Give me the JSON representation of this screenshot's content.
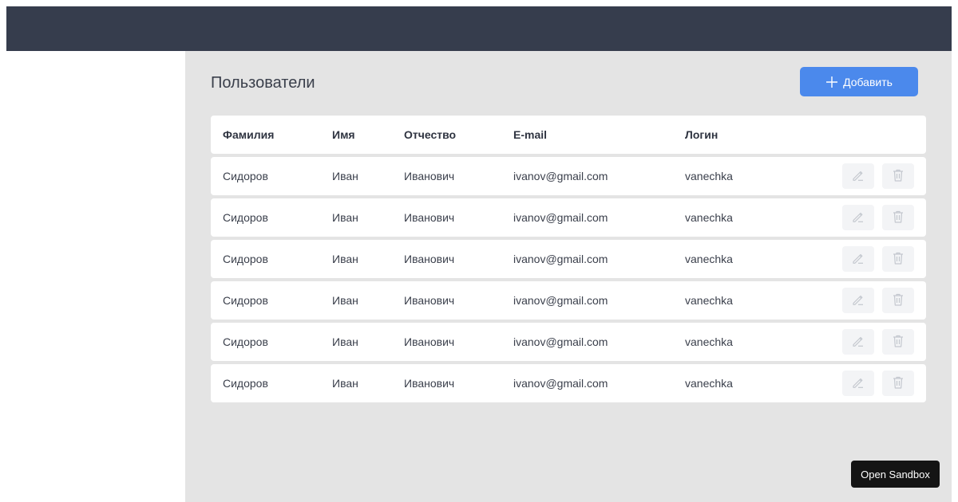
{
  "main": {
    "title": "Пользователи",
    "add_button_label": "Добавить",
    "icons": {
      "add": "plus-icon",
      "edit": "pencil-icon",
      "delete": "trash-icon"
    }
  },
  "table": {
    "headers": {
      "last_name": "Фамилия",
      "first_name": "Имя",
      "middle_name": "Отчество",
      "email": "E-mail",
      "login": "Логин"
    },
    "rows": [
      {
        "last_name": "Сидоров",
        "first_name": "Иван",
        "middle_name": "Иванович",
        "email": "ivanov@gmail.com",
        "login": "vanechka"
      },
      {
        "last_name": "Сидоров",
        "first_name": "Иван",
        "middle_name": "Иванович",
        "email": "ivanov@gmail.com",
        "login": "vanechka"
      },
      {
        "last_name": "Сидоров",
        "first_name": "Иван",
        "middle_name": "Иванович",
        "email": "ivanov@gmail.com",
        "login": "vanechka"
      },
      {
        "last_name": "Сидоров",
        "first_name": "Иван",
        "middle_name": "Иванович",
        "email": "ivanov@gmail.com",
        "login": "vanechka"
      },
      {
        "last_name": "Сидоров",
        "first_name": "Иван",
        "middle_name": "Иванович",
        "email": "ivanov@gmail.com",
        "login": "vanechka"
      },
      {
        "last_name": "Сидоров",
        "first_name": "Иван",
        "middle_name": "Иванович",
        "email": "ivanov@gmail.com",
        "login": "vanechka"
      }
    ]
  },
  "sandbox_button_label": "Open Sandbox",
  "colors": {
    "topbar": "#363d4d",
    "main_background": "#e4e4e4",
    "accent": "#4b89ec",
    "action_icon": "#c4c8cf"
  }
}
